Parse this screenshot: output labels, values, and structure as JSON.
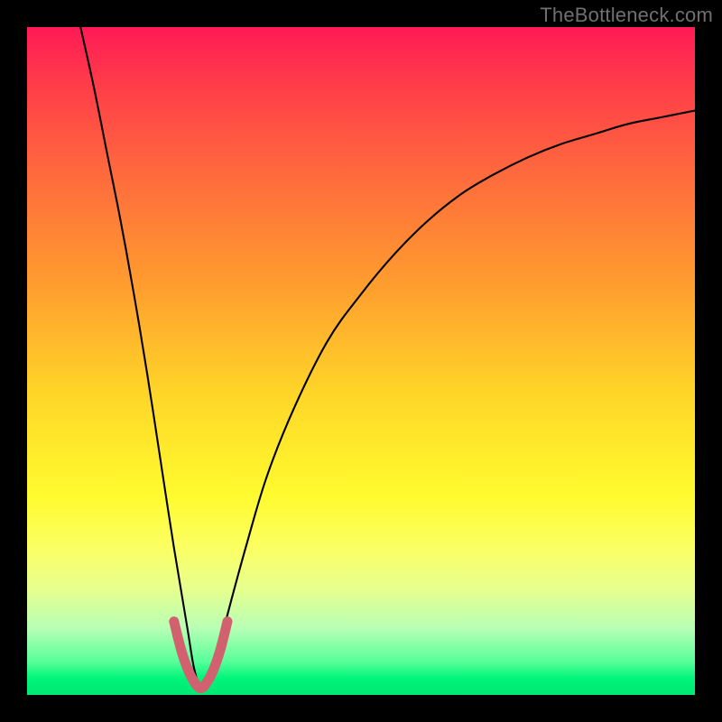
{
  "watermark": "TheBottleneck.com",
  "chart_data": {
    "type": "line",
    "title": "",
    "xlabel": "",
    "ylabel": "",
    "xlim": [
      0,
      100
    ],
    "ylim": [
      0,
      100
    ],
    "series": [
      {
        "name": "bottleneck-curve",
        "x": [
          8,
          10,
          12,
          14,
          16,
          18,
          20,
          22,
          24,
          25,
          26,
          27,
          28,
          30,
          33,
          36,
          40,
          45,
          50,
          55,
          60,
          65,
          70,
          75,
          80,
          85,
          90,
          95,
          100
        ],
        "y": [
          100,
          91,
          81,
          71,
          60,
          48,
          35,
          22,
          10,
          4,
          1,
          1,
          4,
          12,
          23,
          33,
          43,
          53,
          60,
          66,
          71,
          75,
          78,
          80.5,
          82.5,
          84,
          85.5,
          86.5,
          87.5
        ]
      },
      {
        "name": "optimal-zone-marker",
        "x": [
          22,
          23,
          24,
          25,
          26,
          27,
          28,
          29,
          30
        ],
        "y": [
          11,
          7,
          4,
          2,
          1,
          2,
          4,
          7,
          11
        ]
      }
    ],
    "colors": {
      "curve": "#000000",
      "marker": "#d1616f"
    }
  }
}
